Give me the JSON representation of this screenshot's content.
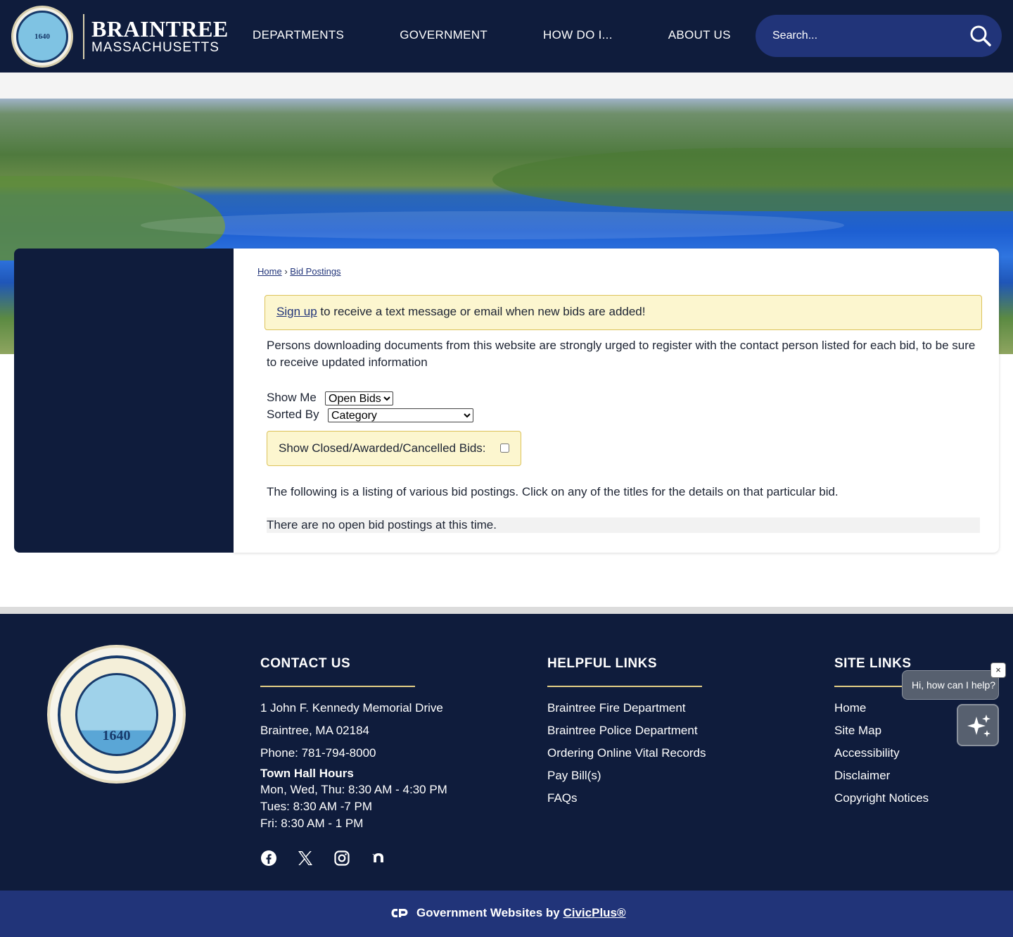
{
  "header": {
    "logo_line1": "BRAINTREE",
    "logo_line2": "MASSACHUSETTS",
    "seal_text": "1640",
    "nav": [
      "DEPARTMENTS",
      "GOVERNMENT",
      "HOW DO I...",
      "ABOUT US"
    ],
    "search_placeholder": "Search..."
  },
  "breadcrumb": {
    "home": "Home",
    "separator": "›",
    "current": "Bid Postings"
  },
  "signup": {
    "link": "Sign up",
    "text": " to receive a text message or email when new bids are added!"
  },
  "notice": "Persons downloading documents from this website are strongly urged to register with the contact person listed for each bid, to be sure to receive updated information",
  "filters": {
    "show_me_label": "Show Me",
    "show_me_value": "Open Bids",
    "sorted_by_label": "Sorted By",
    "sorted_by_value": "Category",
    "closed_label": "Show Closed/Awarded/Cancelled Bids:"
  },
  "listing_note": "The following is a listing of various bid postings. Click on any of the titles for the details on that particular bid.",
  "no_bids": "There are no open bid postings at this time.",
  "footer": {
    "seal_text": "1640",
    "contact": {
      "title": "CONTACT US",
      "address1": "1 John F. Kennedy Memorial Drive",
      "address2": "Braintree, MA 02184",
      "phone": "Phone: 781-794-8000",
      "hours_title": "Town Hall Hours",
      "hours": [
        "Mon, Wed, Thu: 8:30 AM - 4:30 PM",
        "Tues: 8:30 AM -7 PM",
        "Fri: 8:30 AM - 1 PM"
      ]
    },
    "helpful": {
      "title": "HELPFUL LINKS",
      "links": [
        "Braintree Fire Department",
        "Braintree Police Department",
        "Ordering Online Vital Records",
        "Pay Bill(s)",
        "FAQs"
      ]
    },
    "site": {
      "title": "SITE LINKS",
      "links": [
        "Home",
        "Site Map",
        "Accessibility",
        "Disclaimer",
        "Copyright Notices"
      ]
    },
    "social_icons": [
      "facebook-icon",
      "x-icon",
      "instagram-icon",
      "nextdoor-icon"
    ]
  },
  "bottom": {
    "prefix": "Government Websites by ",
    "link": "CivicPlus®"
  },
  "chat": {
    "prompt": "Hi, how can I help?",
    "close": "×"
  },
  "colors": {
    "navy": "#0f1c3c",
    "search_bg": "#213479",
    "alert_bg": "#fcf6cf",
    "accent_gold": "#e4cf85"
  }
}
